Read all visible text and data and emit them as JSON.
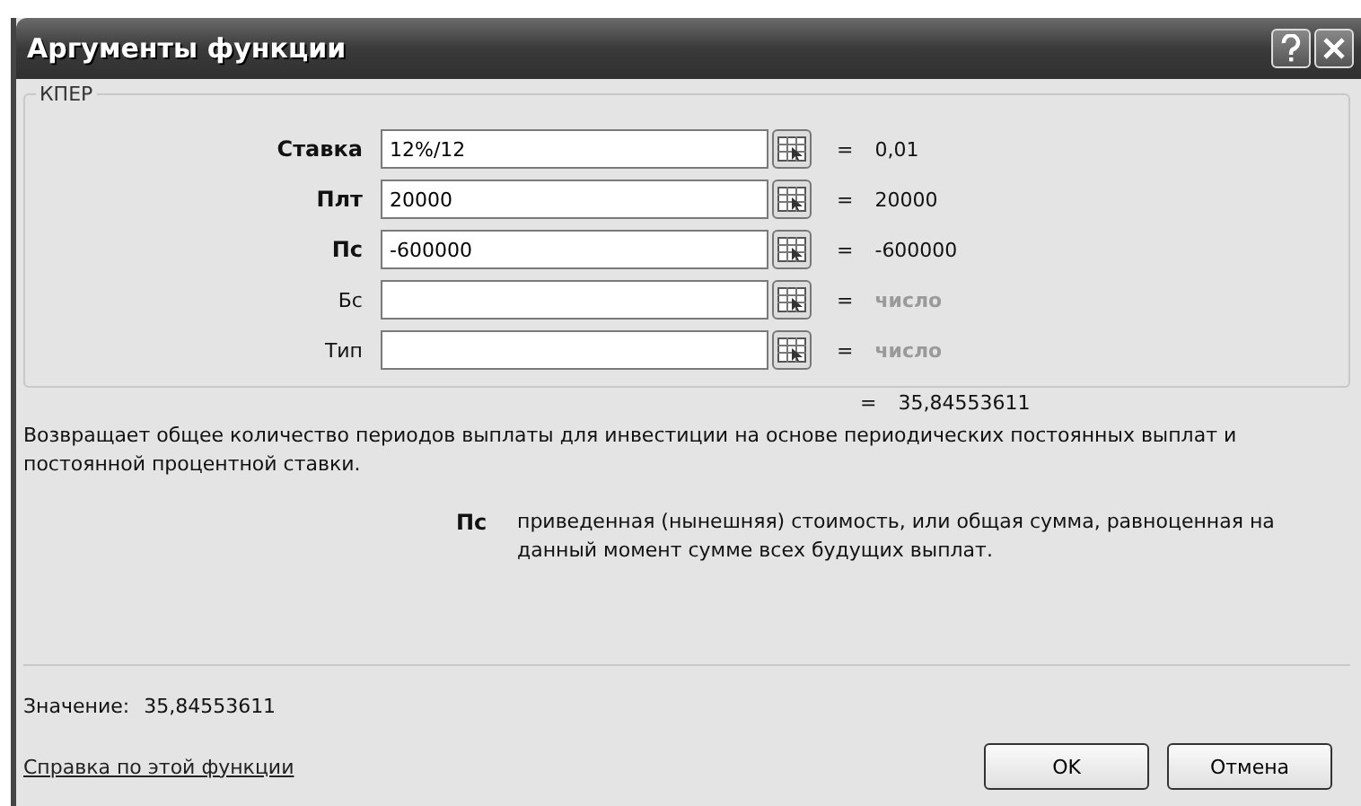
{
  "window": {
    "title": "Аргументы функции"
  },
  "group": {
    "title": "КПЕР",
    "args": [
      {
        "name": "Ставка",
        "required": true,
        "value": "12%/12",
        "result": "0,01",
        "hint": false
      },
      {
        "name": "Плт",
        "required": true,
        "value": "20000",
        "result": "20000",
        "hint": false
      },
      {
        "name": "Пс",
        "required": true,
        "value": "-600000",
        "result": "-600000",
        "hint": false
      },
      {
        "name": "Бс",
        "required": false,
        "result": "число",
        "hint": true
      },
      {
        "name": "Тип",
        "required": false,
        "result": "число",
        "hint": true
      }
    ]
  },
  "equals": "=",
  "formula_result": "35,84553611",
  "description": "Возвращает общее количество периодов выплаты для инвестиции на основе периодических постоянных выплат и постоянной процентной ставки.",
  "arg_help": {
    "name": "Пс",
    "text": "приведенная (нынешняя) стоимость, или общая сумма, равноценная на данный момент сумме всех будущих выплат."
  },
  "value_label": "Значение:",
  "value": "35,84553611",
  "help_link": "Справка по этой функции",
  "buttons": [
    "OK",
    "Отмена"
  ]
}
